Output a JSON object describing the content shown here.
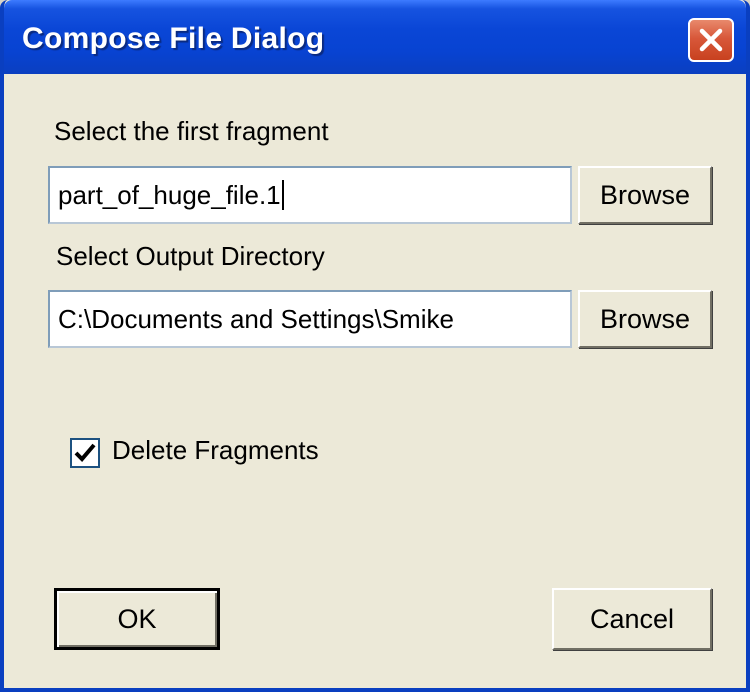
{
  "window": {
    "title": "Compose File Dialog",
    "close_icon": "close-icon"
  },
  "first_fragment": {
    "label": "Select the first fragment",
    "value": "part_of_huge_file.1",
    "browse_label": "Browse"
  },
  "output_dir": {
    "label": "Select Output Directory",
    "value": "C:\\Documents and Settings\\Smike",
    "browse_label": "Browse"
  },
  "delete_fragments": {
    "label": "Delete Fragments",
    "checked": true
  },
  "buttons": {
    "ok": "OK",
    "cancel": "Cancel"
  },
  "colors": {
    "titlebar": "#0a46d6",
    "dialog_bg": "#ece9d8",
    "close_button": "#d8583a"
  }
}
